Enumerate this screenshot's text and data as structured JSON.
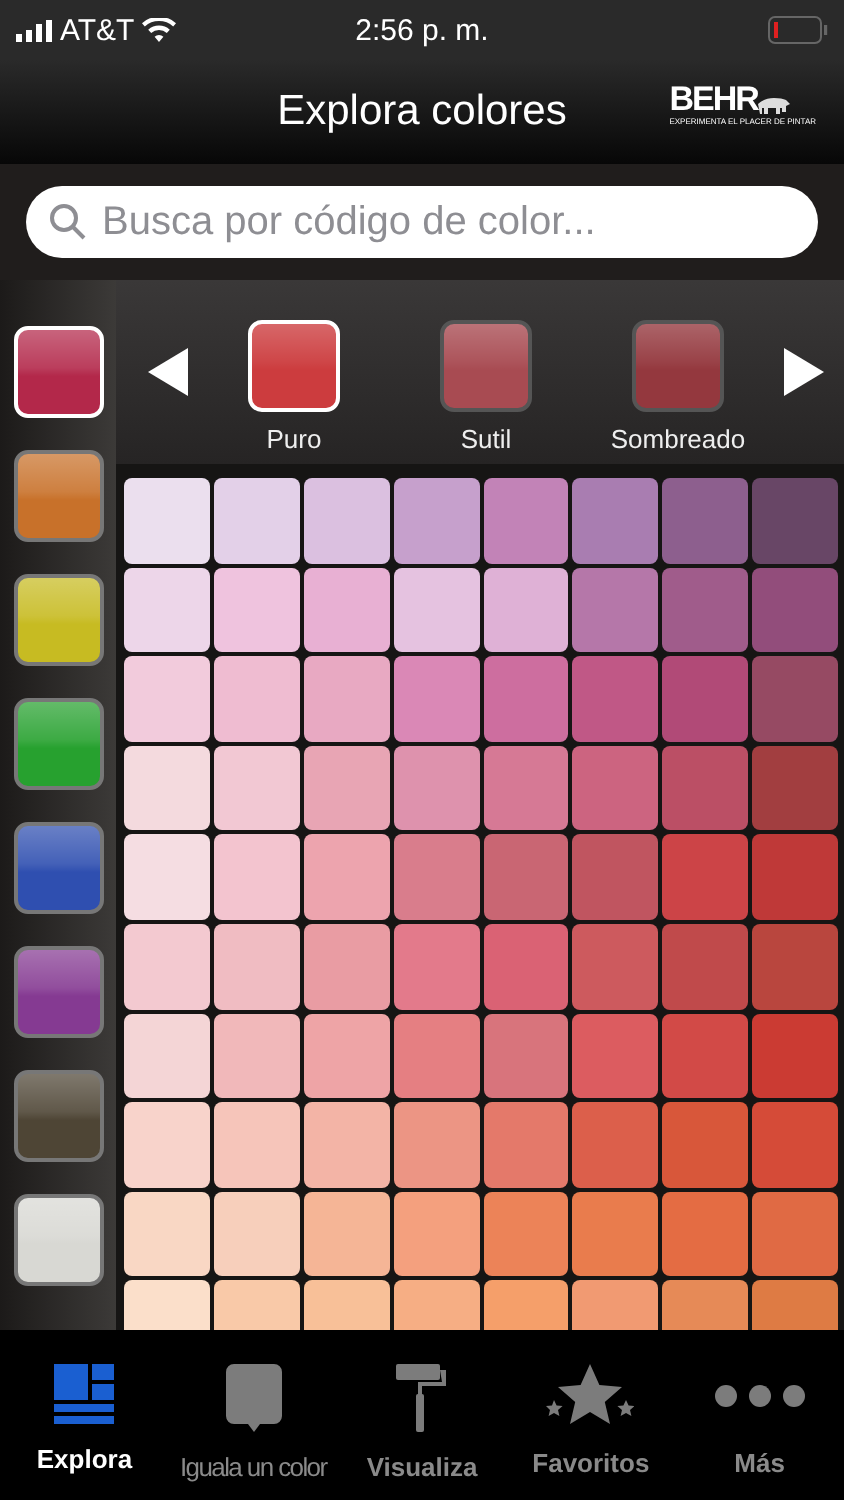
{
  "status_bar": {
    "carrier": "AT&T",
    "time": "2:56 p. m."
  },
  "nav_bar": {
    "title": "Explora colores",
    "logo": {
      "name": "BEHR",
      "tagline": "EXPERIMENTA EL PLACER DE PINTAR"
    }
  },
  "search": {
    "placeholder": "Busca por código de color..."
  },
  "families": [
    {
      "color": "#b3284a",
      "selected": true
    },
    {
      "color": "#c8712a",
      "selected": false
    },
    {
      "color": "#c7bb22",
      "selected": false
    },
    {
      "color": "#27a12f",
      "selected": false
    },
    {
      "color": "#2f4fb0",
      "selected": false
    },
    {
      "color": "#853a92",
      "selected": false
    },
    {
      "color": "#4e4535",
      "selected": false
    },
    {
      "color": "#d8d8d3",
      "selected": false
    }
  ],
  "tones": [
    {
      "label": "Puro",
      "color": "#cc3c3e",
      "selected": true
    },
    {
      "label": "Sutil",
      "color": "#a84b52",
      "selected": false
    },
    {
      "label": "Sombreado",
      "color": "#94383e",
      "selected": false
    }
  ],
  "swatch_grid": [
    [
      {
        "color": "#ebdfee"
      },
      {
        "color": "#e3d0e8"
      },
      {
        "color": "#dbc0e0"
      },
      {
        "color": "#c6a0cc"
      },
      {
        "color": "#c283b7"
      },
      {
        "color": "#a97db1"
      },
      {
        "color": "#8d5f8e"
      },
      {
        "color": "#684666"
      }
    ],
    [
      {
        "color": "#edd6e9"
      },
      {
        "color": "#efc3de"
      },
      {
        "color": "#e8b0d3"
      },
      {
        "color": "#e5c2e0"
      },
      {
        "color": "#dfb1d6"
      },
      {
        "color": "#b577a9"
      },
      {
        "color": "#a05c8b"
      },
      {
        "color": "#924d7b"
      }
    ],
    [
      {
        "color": "#f2cbdc"
      },
      {
        "color": "#efbcd1"
      },
      {
        "color": "#e8a9c2"
      },
      {
        "color": "#da88b6"
      },
      {
        "color": "#cd6e9f"
      },
      {
        "color": "#c05886"
      },
      {
        "color": "#b14a77"
      },
      {
        "color": "#964a63"
      }
    ],
    [
      {
        "color": "#f4dade"
      },
      {
        "color": "#f2c8d3"
      },
      {
        "color": "#e8a5b4"
      },
      {
        "color": "#de92ad"
      },
      {
        "color": "#d67995"
      },
      {
        "color": "#cc6480"
      },
      {
        "color": "#bb4f65"
      },
      {
        "color": "#a23e40"
      }
    ],
    [
      {
        "color": "#f5dde2"
      },
      {
        "color": "#f3c4cf"
      },
      {
        "color": "#eda4ae"
      },
      {
        "color": "#d97d8c"
      },
      {
        "color": "#c96673"
      },
      {
        "color": "#c05560"
      },
      {
        "color": "#cc4447"
      },
      {
        "color": "#bf3938"
      }
    ],
    [
      {
        "color": "#f3c9d0"
      },
      {
        "color": "#f0bcc2"
      },
      {
        "color": "#e99ca3"
      },
      {
        "color": "#e37a8b"
      },
      {
        "color": "#da6274"
      },
      {
        "color": "#cd5a5e"
      },
      {
        "color": "#c04a4b"
      },
      {
        "color": "#b9463e"
      }
    ],
    [
      {
        "color": "#f4d5d6"
      },
      {
        "color": "#f1b8ba"
      },
      {
        "color": "#eea4a6"
      },
      {
        "color": "#e57f82"
      },
      {
        "color": "#d8747c"
      },
      {
        "color": "#dc5c60"
      },
      {
        "color": "#d24a47"
      },
      {
        "color": "#cb3b33"
      }
    ],
    [
      {
        "color": "#f8d3cb"
      },
      {
        "color": "#f6c5ba"
      },
      {
        "color": "#f3b4a6"
      },
      {
        "color": "#ec9584"
      },
      {
        "color": "#e4796a"
      },
      {
        "color": "#dc5f4b"
      },
      {
        "color": "#d8573a"
      },
      {
        "color": "#d54b38"
      }
    ],
    [
      {
        "color": "#f9d7c4"
      },
      {
        "color": "#f7cfbb"
      },
      {
        "color": "#f5b596"
      },
      {
        "color": "#f4a07e"
      },
      {
        "color": "#ec8358"
      },
      {
        "color": "#e97c4d"
      },
      {
        "color": "#e46c43"
      },
      {
        "color": "#e06a44"
      }
    ],
    [
      {
        "color": "#fbdfca"
      },
      {
        "color": "#f9c9a8"
      },
      {
        "color": "#f8c098"
      },
      {
        "color": "#f6ae84"
      },
      {
        "color": "#f59f6a"
      },
      {
        "color": "#f19a72"
      },
      {
        "color": "#e68a57"
      },
      {
        "color": "#de7b44"
      }
    ]
  ],
  "tab_bar": [
    {
      "kind": "explore",
      "label": "Explora",
      "selected": true
    },
    {
      "kind": "match",
      "label": "Iguala un color",
      "selected": false
    },
    {
      "kind": "visualize",
      "label": "Visualiza",
      "selected": false
    },
    {
      "kind": "favorites",
      "label": "Favoritos",
      "selected": false
    },
    {
      "kind": "more",
      "label": "Más",
      "selected": false
    }
  ]
}
